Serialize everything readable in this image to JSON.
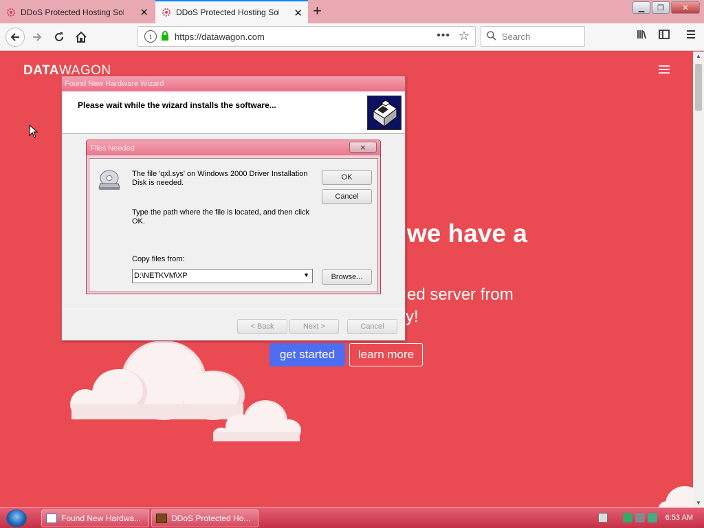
{
  "browser": {
    "tabs": [
      {
        "title": "DDoS Protected Hosting Solutio",
        "active": false
      },
      {
        "title": "DDoS Protected Hosting Solutio",
        "active": true
      }
    ],
    "url": "https://datawagon.com",
    "search_placeholder": "Search"
  },
  "page": {
    "brand_bold": "DATA",
    "brand_light": "WAGON",
    "hero_heading": "we have a",
    "hero_sub1": "ed server from",
    "hero_sub2": "y!",
    "cta_primary": "get started",
    "cta_secondary": "learn more",
    "colors": {
      "background": "#ea4a51",
      "primary_button": "#4e6ef2"
    }
  },
  "wizard": {
    "title": "Found New Hardware Wizard",
    "header_text": "Please wait while the wizard installs the software...",
    "back_label": "< Back",
    "next_label": "Next >",
    "cancel_label": "Cancel"
  },
  "dialog": {
    "title": "Files Needed",
    "close_glyph": "⨯",
    "message1": "The file 'qxl.sys' on Windows 2000 Driver Installation Disk is needed.",
    "message2": "Type the path where the file is located, and then click OK.",
    "copy_label": "Copy files from:",
    "copy_value": "D:\\NETKVM\\XP",
    "ok_label": "OK",
    "cancel_label": "Cancel",
    "browse_label": "Browse..."
  },
  "taskbar": {
    "items": [
      {
        "label": "Found New Hardwa..."
      },
      {
        "label": "DDoS Protected Ho..."
      }
    ],
    "clock": "6:53 AM"
  }
}
